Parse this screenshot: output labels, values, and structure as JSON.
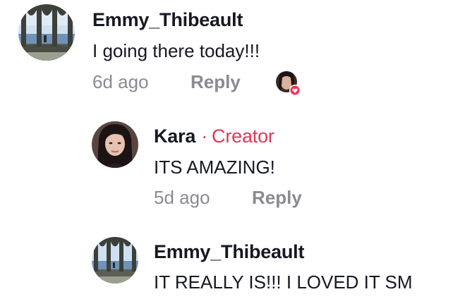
{
  "comments": [
    {
      "username": "Emmy_Thibeault",
      "text": "I going there today!!!",
      "time": "6d ago",
      "reply_label": "Reply",
      "avatar": "beach-arches-avatar",
      "creator_liked": true
    },
    {
      "username": "Kara",
      "badge_separator": "·",
      "badge": "Creator",
      "text": "ITS AMAZING!",
      "time": "5d ago",
      "reply_label": "Reply",
      "avatar": "woman-portrait-avatar"
    },
    {
      "username": "Emmy_Thibeault",
      "text": "IT REALLY IS!!! I LOVED IT SM",
      "avatar": "beach-arches-avatar"
    }
  ],
  "colors": {
    "text": "#161823",
    "muted": "#8a8b91",
    "creator": "#e0375a",
    "heart": "#fe2c55"
  }
}
